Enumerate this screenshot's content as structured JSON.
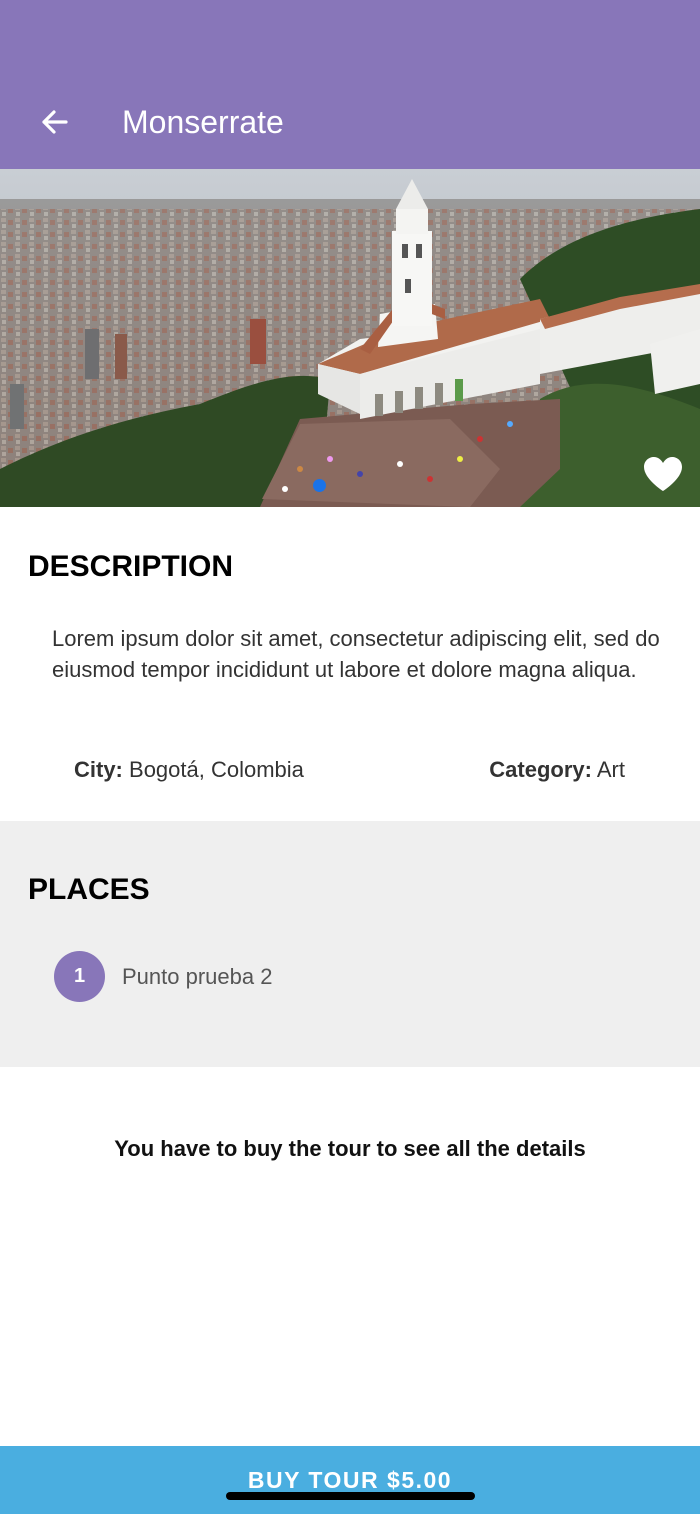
{
  "colors": {
    "primary": "#8876b9",
    "accent_blue": "#4aaee0",
    "pager_active": "#1a73e8",
    "places_background": "#efefef"
  },
  "app_bar": {
    "title": "Monserrate",
    "back_icon": "arrow-left-icon"
  },
  "hero": {
    "favorite_icon": "heart-icon",
    "pager_active_index": 0
  },
  "description": {
    "heading": "DESCRIPTION",
    "text": "Lorem ipsum dolor sit amet, consectetur adipiscing elit, sed do eiusmod tempor incididunt ut labore et dolore magna aliqua.",
    "city_label": "City:",
    "city_value": "Bogotá, Colombia",
    "category_label": "Category:",
    "category_value": "Art"
  },
  "places": {
    "heading": "PLACES",
    "items": [
      {
        "number": "1",
        "name": "Punto prueba 2"
      }
    ]
  },
  "notice": "You have to buy the tour to see all the details",
  "buy_button": {
    "label": "BUY TOUR $5.00"
  }
}
